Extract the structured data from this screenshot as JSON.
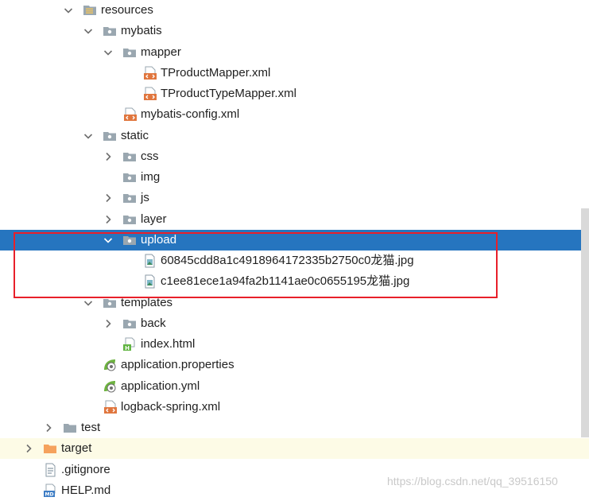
{
  "tree": {
    "resources": "resources",
    "mybatis": "mybatis",
    "mapper": "mapper",
    "tproduct_mapper": "TProductMapper.xml",
    "tproducttype_mapper": "TProductTypeMapper.xml",
    "mybatis_config": "mybatis-config.xml",
    "static": "static",
    "css": "css",
    "img": "img",
    "js": "js",
    "layer": "layer",
    "upload": "upload",
    "upload_file_1": "60845cdd8a1c4918964172335b2750c0龙猫.jpg",
    "upload_file_2": "c1ee81ece1a94fa2b1141ae0c0655195龙猫.jpg",
    "templates": "templates",
    "back": "back",
    "index_html": "index.html",
    "app_properties": "application.properties",
    "app_yml": "application.yml",
    "logback": "logback-spring.xml",
    "test": "test",
    "target": "target",
    "gitignore": ".gitignore",
    "help_md": "HELP.md"
  },
  "icons": {
    "folder": "folder-icon",
    "resources_folder": "resources-folder-icon",
    "excluded_folder": "excluded-folder-icon",
    "xml_file": "xml-file-icon",
    "image_file": "image-file-icon",
    "html_file": "html-file-icon",
    "spring_config": "spring-config-icon",
    "text_file": "text-file-icon",
    "markdown_file": "markdown-file-icon"
  },
  "colors": {
    "selection": "#2675bf",
    "highlight_box": "#e8202a",
    "excluded_folder": "#f5a25d",
    "folder": "#9aa7b0"
  },
  "watermark": "https://blog.csdn.net/qq_39516150"
}
